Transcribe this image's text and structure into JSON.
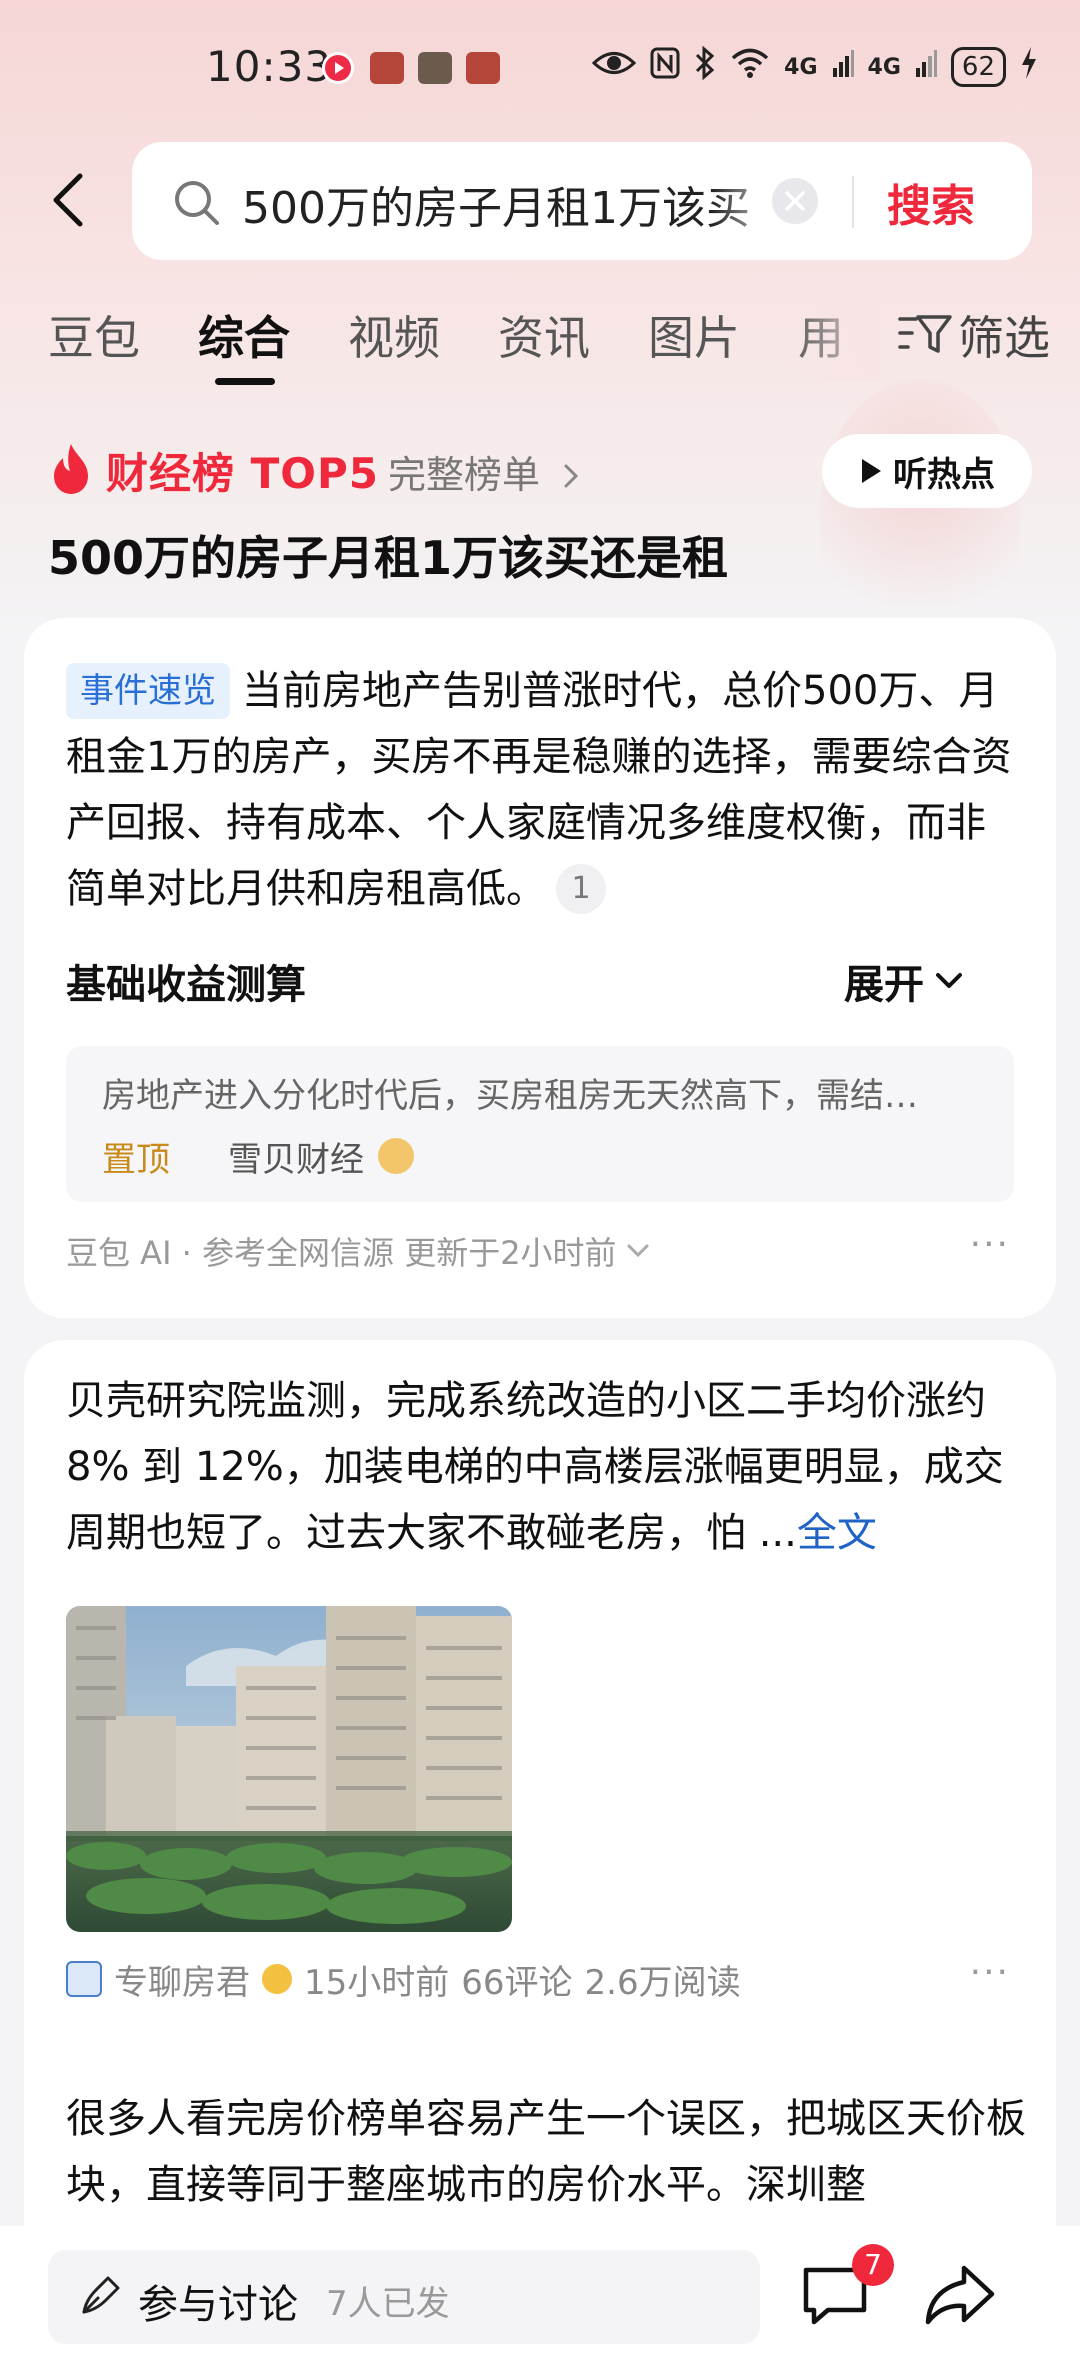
{
  "status_bar": {
    "time": "10:33",
    "battery": "62",
    "signal1": "4G",
    "signal2": "4G"
  },
  "search": {
    "query": "500万的房子月租1万该买",
    "submit_label": "搜索"
  },
  "tabs": [
    {
      "label": "豆包"
    },
    {
      "label": "综合"
    },
    {
      "label": "视频"
    },
    {
      "label": "资讯"
    },
    {
      "label": "图片"
    },
    {
      "label": "用"
    }
  ],
  "filter_label": "筛选",
  "ranking": {
    "title": "财经榜 TOP5",
    "full_list_label": "完整榜单",
    "listen_label": "听热点",
    "topic": "500万的房子月租1万该买还是租"
  },
  "ai_card": {
    "event_tag": "事件速览",
    "summary": "当前房地产告别普涨时代，总价500万、月租金1万的房产，买房不再是稳赚的选择，需要综合资产回报、持有成本、个人家庭情况多维度权衡，而非简单对比月供和房租高低。",
    "ref_number": "1",
    "section_title": "基础收益测算",
    "expand_label": "展开",
    "source_snippet": "房地产进入分化时代后，买房租房无天然高下，需结…",
    "pin_label": "置顶",
    "source_name": "雪贝财经",
    "footer": "豆包 AI · 参考全网信源 更新于2小时前"
  },
  "article1": {
    "text": "贝壳研究院监测，完成系统改造的小区二手均价涨约 8% 到 12%，加装电梯的中高楼层涨幅更明显，成交周期也短了。过去大家不敢碰老房，怕",
    "ellipsis": "...",
    "fulltext_label": "全文",
    "author": "专聊房君",
    "time": "15小时前",
    "comments": "66评论",
    "reads": "2.6万阅读"
  },
  "article2": {
    "text": "很多人看完房价榜单容易产生一个误区，把城区天价板块，直接等同于整座城市的房价水平。深圳整"
  },
  "bottom_bar": {
    "discuss_label": "参与讨论",
    "discuss_count": "7人已发",
    "comment_badge": "7"
  },
  "colors": {
    "accent_red": "#f0283c",
    "link_blue": "#1f63c7",
    "tag_blue": "#2a6fd6",
    "pin_gold": "#c98a1a"
  }
}
